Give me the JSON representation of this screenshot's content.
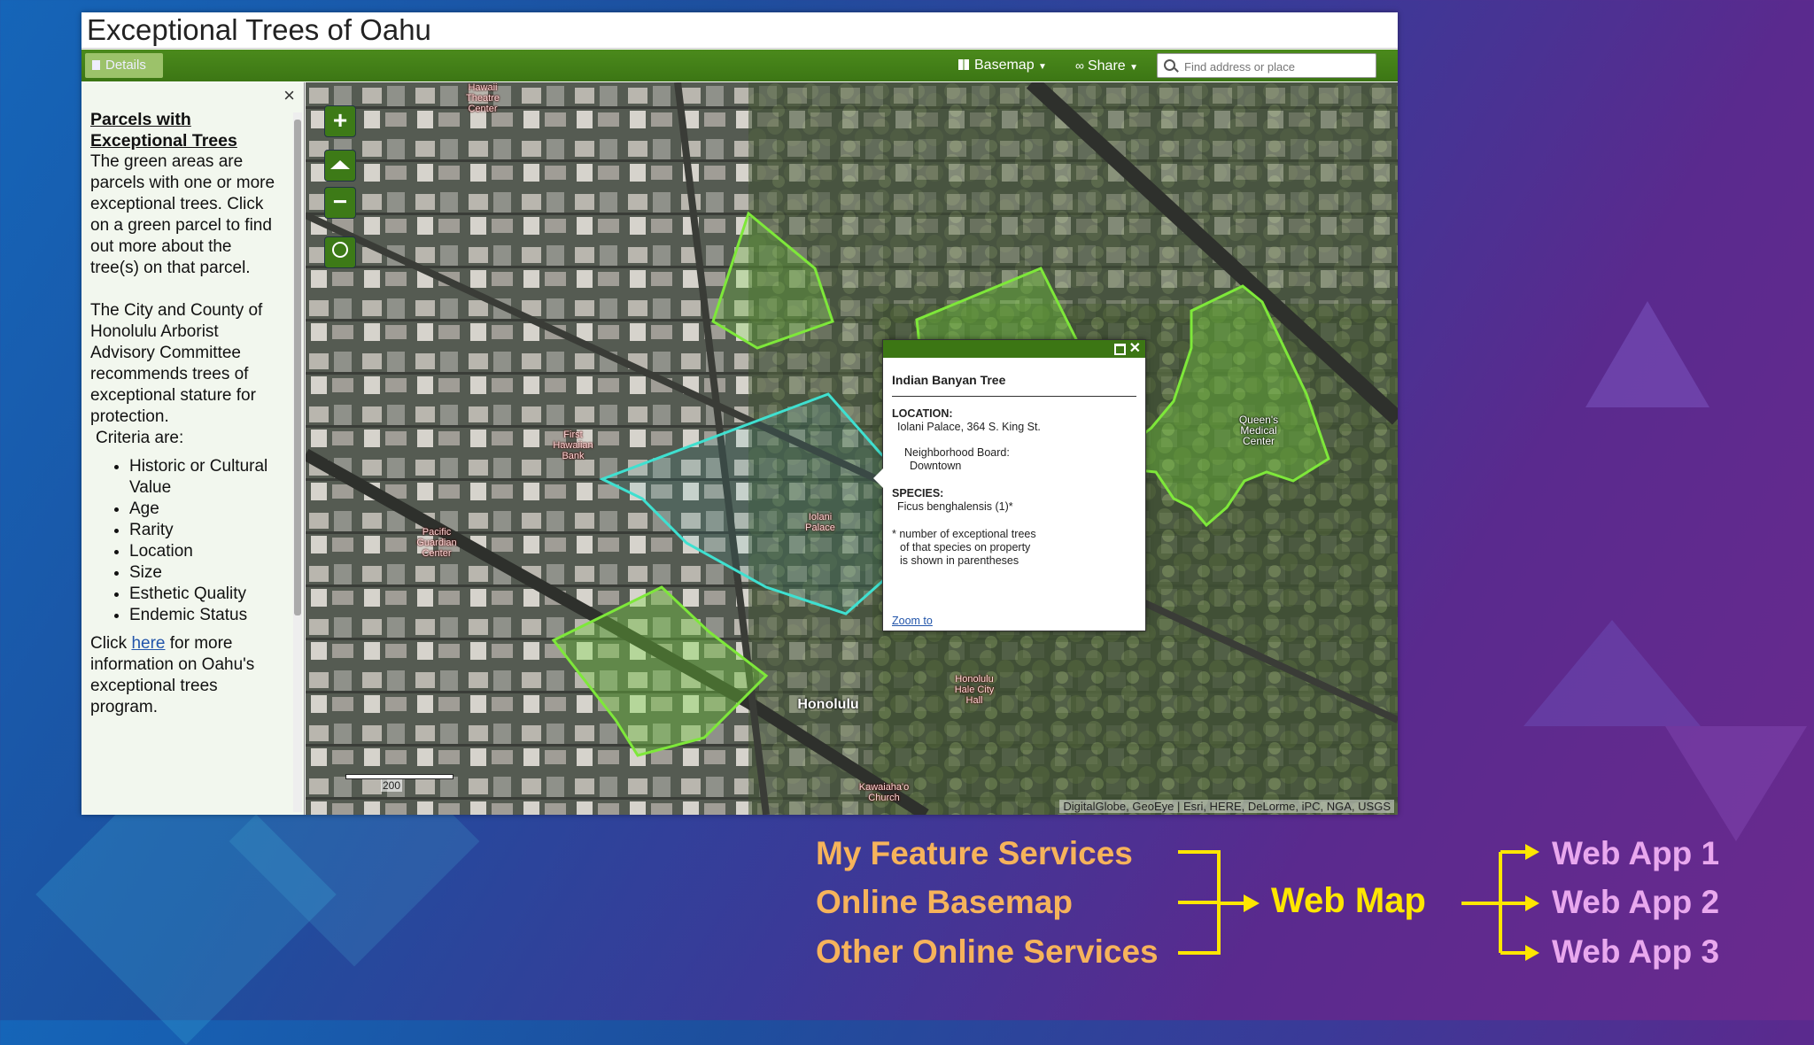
{
  "app": {
    "title": "Exceptional Trees of Oahu"
  },
  "toolbar": {
    "details_label": "Details",
    "basemap_label": "Basemap",
    "share_label": "Share",
    "search_placeholder": "Find address or place"
  },
  "panel": {
    "close_label": "×",
    "heading": "Parcels with Exceptional Trees",
    "intro": "The green areas are parcels with one or more exceptional trees. Click on a green parcel to find out more about the tree(s) on that parcel.",
    "para2": "The City and County of Honolulu Arborist Advisory Committee recommends trees of exceptional stature for protection.",
    "criteria_label": "Criteria are:",
    "criteria": [
      "Historic or Cultural Value",
      "Age",
      "Rarity",
      "Location",
      "Size",
      "Esthetic Quality",
      "Endemic Status"
    ],
    "click_prefix": "Click ",
    "here_link": "here",
    "click_suffix": " for more information on Oahu's exceptional trees program."
  },
  "map": {
    "zoom_in": "+",
    "zoom_out": "−",
    "scale_label": "200",
    "attribution": "DigitalGlobe, GeoEye | Esri, HERE, DeLorme, iPC, NGA, USGS",
    "labels": {
      "hawaii_theatre": "Hawaii Theatre Center",
      "first_hawaiian": "First Hawaiian Bank",
      "pacific_guardian": "Pacific Guardian Center",
      "iolani_palace": "Iolani Palace",
      "queens_medical": "Queen's Medical Center",
      "honolulu_hale": "Honolulu Hale City Hall",
      "kawaiahao": "Kawaiaha'o Church",
      "honolulu": "Honolulu"
    }
  },
  "popup": {
    "title": "Indian Banyan Tree",
    "location_label": "LOCATION:",
    "location_value": "Iolani Palace, 364 S. King St.",
    "board_label": "Neighborhood Board:",
    "board_value": "Downtown",
    "species_label": "SPECIES:",
    "species_value": "Ficus benghalensis (1)*",
    "note_line1": "* number of exceptional trees",
    "note_line2": "of that species on property",
    "note_line3": "is shown in parentheses",
    "zoom_link": "Zoom to",
    "close_label": "✕"
  },
  "diagram": {
    "sources": [
      "My Feature Services",
      "Online Basemap",
      "Other Online Services"
    ],
    "center": "Web Map",
    "apps": [
      "Web App 1",
      "Web App 2",
      "Web App 3"
    ],
    "colors": {
      "sources": "#f6b35b",
      "center": "#ffe600",
      "apps": "#e9a8ee",
      "connector": "#ffe600"
    }
  }
}
